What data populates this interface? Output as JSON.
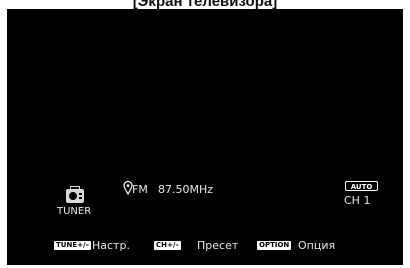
{
  "caption": "[Экран телевизора]",
  "source": {
    "icon": "radio-icon",
    "label": "TUNER"
  },
  "band": {
    "icon": "location-pin-icon",
    "name": "FM",
    "frequency": "87.50MHz"
  },
  "mode": {
    "badge": "AUTO",
    "channel": "CH 1"
  },
  "controls": [
    {
      "key": "TUNE+/–",
      "label": "Настр."
    },
    {
      "key": "CH+/–",
      "label": "Пресет"
    },
    {
      "key": "OPTION",
      "label": "Опция"
    }
  ],
  "colors": {
    "screen_background": "#000000",
    "text": "#e8e8e8",
    "key_background": "#ffffff"
  }
}
